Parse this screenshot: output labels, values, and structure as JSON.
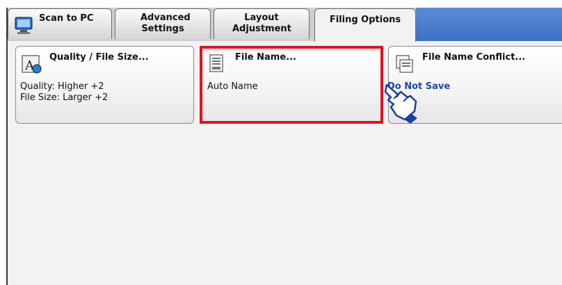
{
  "tabs": [
    {
      "label": "Scan to PC",
      "icon": "computer-icon"
    },
    {
      "label": "Advanced Settings"
    },
    {
      "label": "Layout Adjustment"
    },
    {
      "label": "Filing Options",
      "active": true
    }
  ],
  "cards": {
    "quality": {
      "title": "Quality / File Size...",
      "icon": "quality-file-size-icon",
      "lines": [
        "Quality: Higher +2",
        "File Size: Larger +2"
      ]
    },
    "file_name": {
      "title": "File Name...",
      "icon": "file-name-icon",
      "value": "Auto Name"
    },
    "conflict": {
      "title": "File Name Conflict...",
      "icon": "file-name-conflict-icon",
      "value": "Do Not Save"
    }
  },
  "colors": {
    "highlight": "#e8101b",
    "tab_bar_accent": "#4a7fd0",
    "value_blue": "#1a47a8"
  }
}
